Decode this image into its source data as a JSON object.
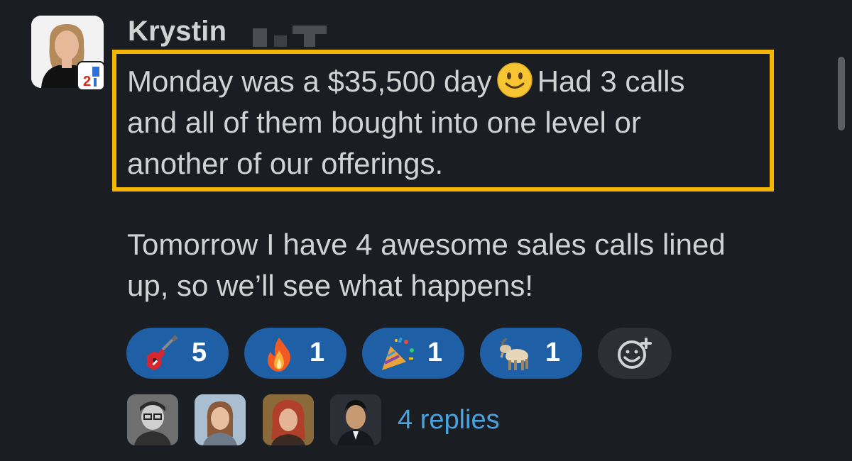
{
  "message": {
    "author": "Krystin",
    "line1_a": "Monday was a $35,500 day",
    "line1_b": "Had 3 calls",
    "line2": "and all of them bought into one level or",
    "line3": "another of our offerings.",
    "line4": "Tomorrow I have 4 awesome sales calls lined",
    "line5": "up, so we’ll see what happens!",
    "inline_emoji": "slightly-smiling-face"
  },
  "reactions": [
    {
      "icon": "guitar-icon",
      "count": "5"
    },
    {
      "icon": "fire-icon",
      "count": "1"
    },
    {
      "icon": "party-popper-icon",
      "count": "1"
    },
    {
      "icon": "goat-icon",
      "count": "1"
    }
  ],
  "thread": {
    "replies_label": "4 replies"
  },
  "colors": {
    "background": "#1a1d21",
    "text": "#d1d2d3",
    "highlight": "#f5b500",
    "reaction_bg": "#1f5fa6",
    "link": "#4aa3df"
  }
}
